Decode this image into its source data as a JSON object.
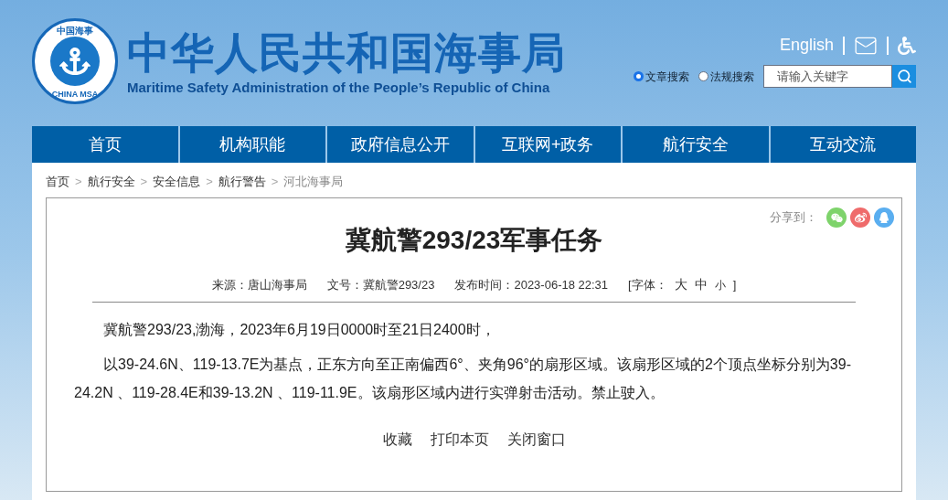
{
  "header": {
    "logo": {
      "top_text": "中国海事",
      "bottom_text": "CHINA MSA"
    },
    "title": "中华人民共和国海事局",
    "subtitle": "Maritime Safety Administration of the People’s Republic of China",
    "language_link": "English",
    "search_options": [
      {
        "label": "文章搜索",
        "selected": true
      },
      {
        "label": "法规搜索",
        "selected": false
      }
    ],
    "search": {
      "placeholder": "请输入关键字"
    }
  },
  "nav": [
    {
      "label": "首页"
    },
    {
      "label": "机构职能"
    },
    {
      "label": "政府信息公开"
    },
    {
      "label": "互联网+政务"
    },
    {
      "label": "航行安全"
    },
    {
      "label": "互动交流"
    }
  ],
  "breadcrumb": [
    {
      "label": "首页",
      "current": false
    },
    {
      "label": "航行安全",
      "current": false
    },
    {
      "label": "安全信息",
      "current": false
    },
    {
      "label": "航行警告",
      "current": false
    },
    {
      "label": "河北海事局",
      "current": true
    }
  ],
  "breadcrumb_separator": ">",
  "article": {
    "share_label": "分享到：",
    "share": [
      {
        "kind": "wechat",
        "color": "#7ed36b"
      },
      {
        "kind": "weibo",
        "color": "#ef6b6b"
      },
      {
        "kind": "qq",
        "color": "#5aaef0"
      }
    ],
    "title": "冀航警293/23军事任务",
    "meta": [
      "来源：唐山海事局",
      "文号：冀航警293/23",
      "发布时间：2023-06-18 22:31"
    ],
    "font_size": {
      "open": "[字体：",
      "options": [
        "大",
        "中",
        "小"
      ],
      "close": "]"
    },
    "paragraphs": [
      "冀航警293/23,渤海，2023年6月19日0000时至21日2400时，",
      "以39-24.6N、119-13.7E为基点，正东方向至正南偏西6°、夹角96°的扇形区域。该扇形区域的2个顶点坐标分别为39-24.2N 、119-28.4E和39-13.2N 、119-11.9E。该扇形区域内进行实弹射击活动。禁止驶入。"
    ],
    "actions": [
      "收藏",
      "打印本页",
      "关闭窗口"
    ]
  }
}
